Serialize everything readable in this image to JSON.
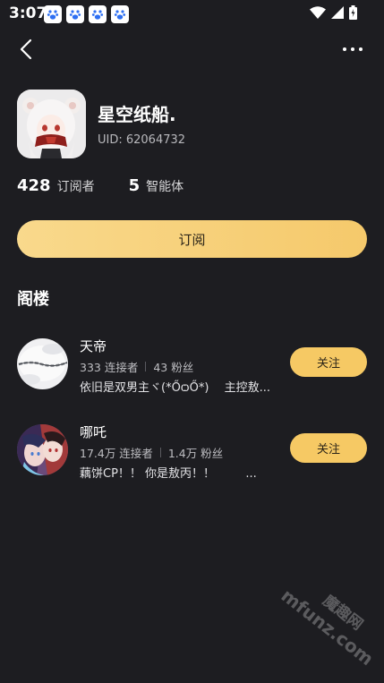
{
  "status_bar": {
    "time": "3:07",
    "notification_icons": [
      "baidu-paw-icon",
      "baidu-paw-icon",
      "baidu-paw-icon",
      "baidu-paw-icon"
    ]
  },
  "profile": {
    "name": "星空纸船.",
    "uid": "UID: 62064732"
  },
  "stats": {
    "subscribers_count": "428",
    "subscribers_label": "订阅者",
    "agents_count": "5",
    "agents_label": "智能体"
  },
  "subscribe_button": "订阅",
  "section_title": "阁楼",
  "items": [
    {
      "name": "天帝",
      "connectors": "333 连接者",
      "fans": "43 粉丝",
      "description": "依旧是双男主ヾ(*ŐѻŐ*)　 主控敖...",
      "follow_label": "关注"
    },
    {
      "name": "哪吒",
      "connectors": "17.4万 连接者",
      "fans": "1.4万 粉丝",
      "description": "藕饼CP！！ 你是敖丙！！ 　　 ...",
      "follow_label": "关注"
    }
  ],
  "watermark": {
    "line1": "魔趣网",
    "line2": "mfunz.com"
  },
  "colors": {
    "background": "#1d1d21",
    "accent": "#f6c964",
    "accent_gradient_start": "#f9d98c",
    "accent_gradient_end": "#f5c96b"
  }
}
